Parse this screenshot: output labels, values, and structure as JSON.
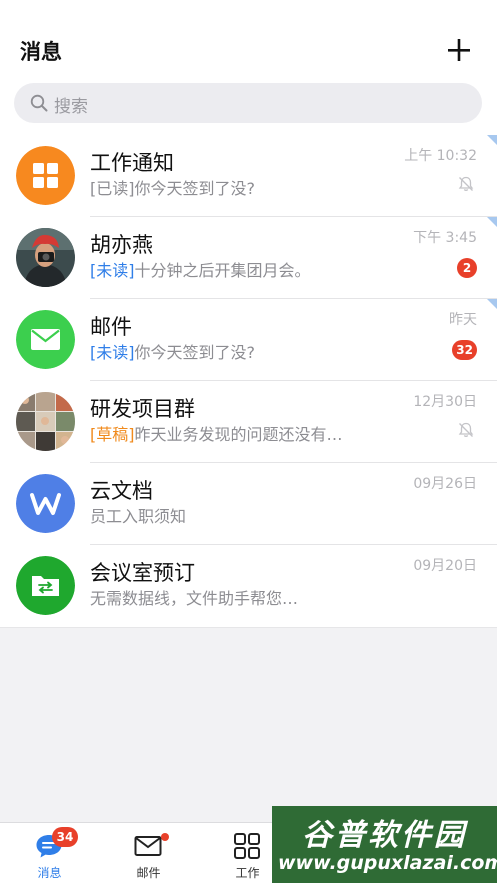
{
  "header": {
    "title": "消息",
    "plus_icon": "plus-icon"
  },
  "search": {
    "placeholder": "搜索",
    "icon": "search-icon"
  },
  "conversations": [
    {
      "title": "工作通知",
      "tag": "[已读]",
      "tag_type": "read",
      "preview": "你今天签到了没?",
      "time": "上午 10:32",
      "muted": true,
      "badge": null,
      "pinned": true,
      "avatar": "grid-app-icon",
      "avatar_color": "#f7891f"
    },
    {
      "title": "胡亦燕",
      "tag": "[未读]",
      "tag_type": "unread",
      "preview": "十分钟之后开集团月会。",
      "time": "下午 3:45",
      "muted": false,
      "badge": "2",
      "pinned": true,
      "avatar": "person-photo-avatar",
      "avatar_color": "#2d3a3c"
    },
    {
      "title": "邮件",
      "tag": "[未读]",
      "tag_type": "unread",
      "preview": "你今天签到了没?",
      "time": "昨天",
      "muted": false,
      "badge": "32",
      "pinned": true,
      "avatar": "mail-icon",
      "avatar_color": "#3ccf4e"
    },
    {
      "title": "研发项目群",
      "tag": "[草稿]",
      "tag_type": "draft",
      "preview": "昨天业务发现的问题还没有…",
      "time": "12月30日",
      "muted": true,
      "badge": null,
      "pinned": false,
      "avatar": "group-photo-avatar",
      "avatar_color": "#6b5a4a"
    },
    {
      "title": "云文档",
      "tag": "",
      "tag_type": "none",
      "preview": "员工入职须知",
      "time": "09月26日",
      "muted": false,
      "badge": null,
      "pinned": false,
      "avatar": "wps-doc-icon",
      "avatar_color": "#4f7fe6"
    },
    {
      "title": "会议室预订",
      "tag": "",
      "tag_type": "none",
      "preview": "无需数据线，文件助手帮您…",
      "time": "09月20日",
      "muted": false,
      "badge": null,
      "pinned": false,
      "avatar": "file-transfer-icon",
      "avatar_color": "#1fa82e"
    }
  ],
  "tabbar": {
    "tabs": [
      {
        "label": "消息",
        "icon": "chat-bubble-icon",
        "badge": "34",
        "active": true
      },
      {
        "label": "邮件",
        "icon": "envelope-icon",
        "dot": true,
        "active": false
      },
      {
        "label": "工作",
        "icon": "apps-grid-icon",
        "active": false
      }
    ]
  },
  "watermark": {
    "brand": "谷普软件园",
    "url": "www.gupuxlazai.com"
  },
  "colors": {
    "accent": "#2f7ee8",
    "badge": "#e8402a",
    "draft": "#f08a1c"
  }
}
